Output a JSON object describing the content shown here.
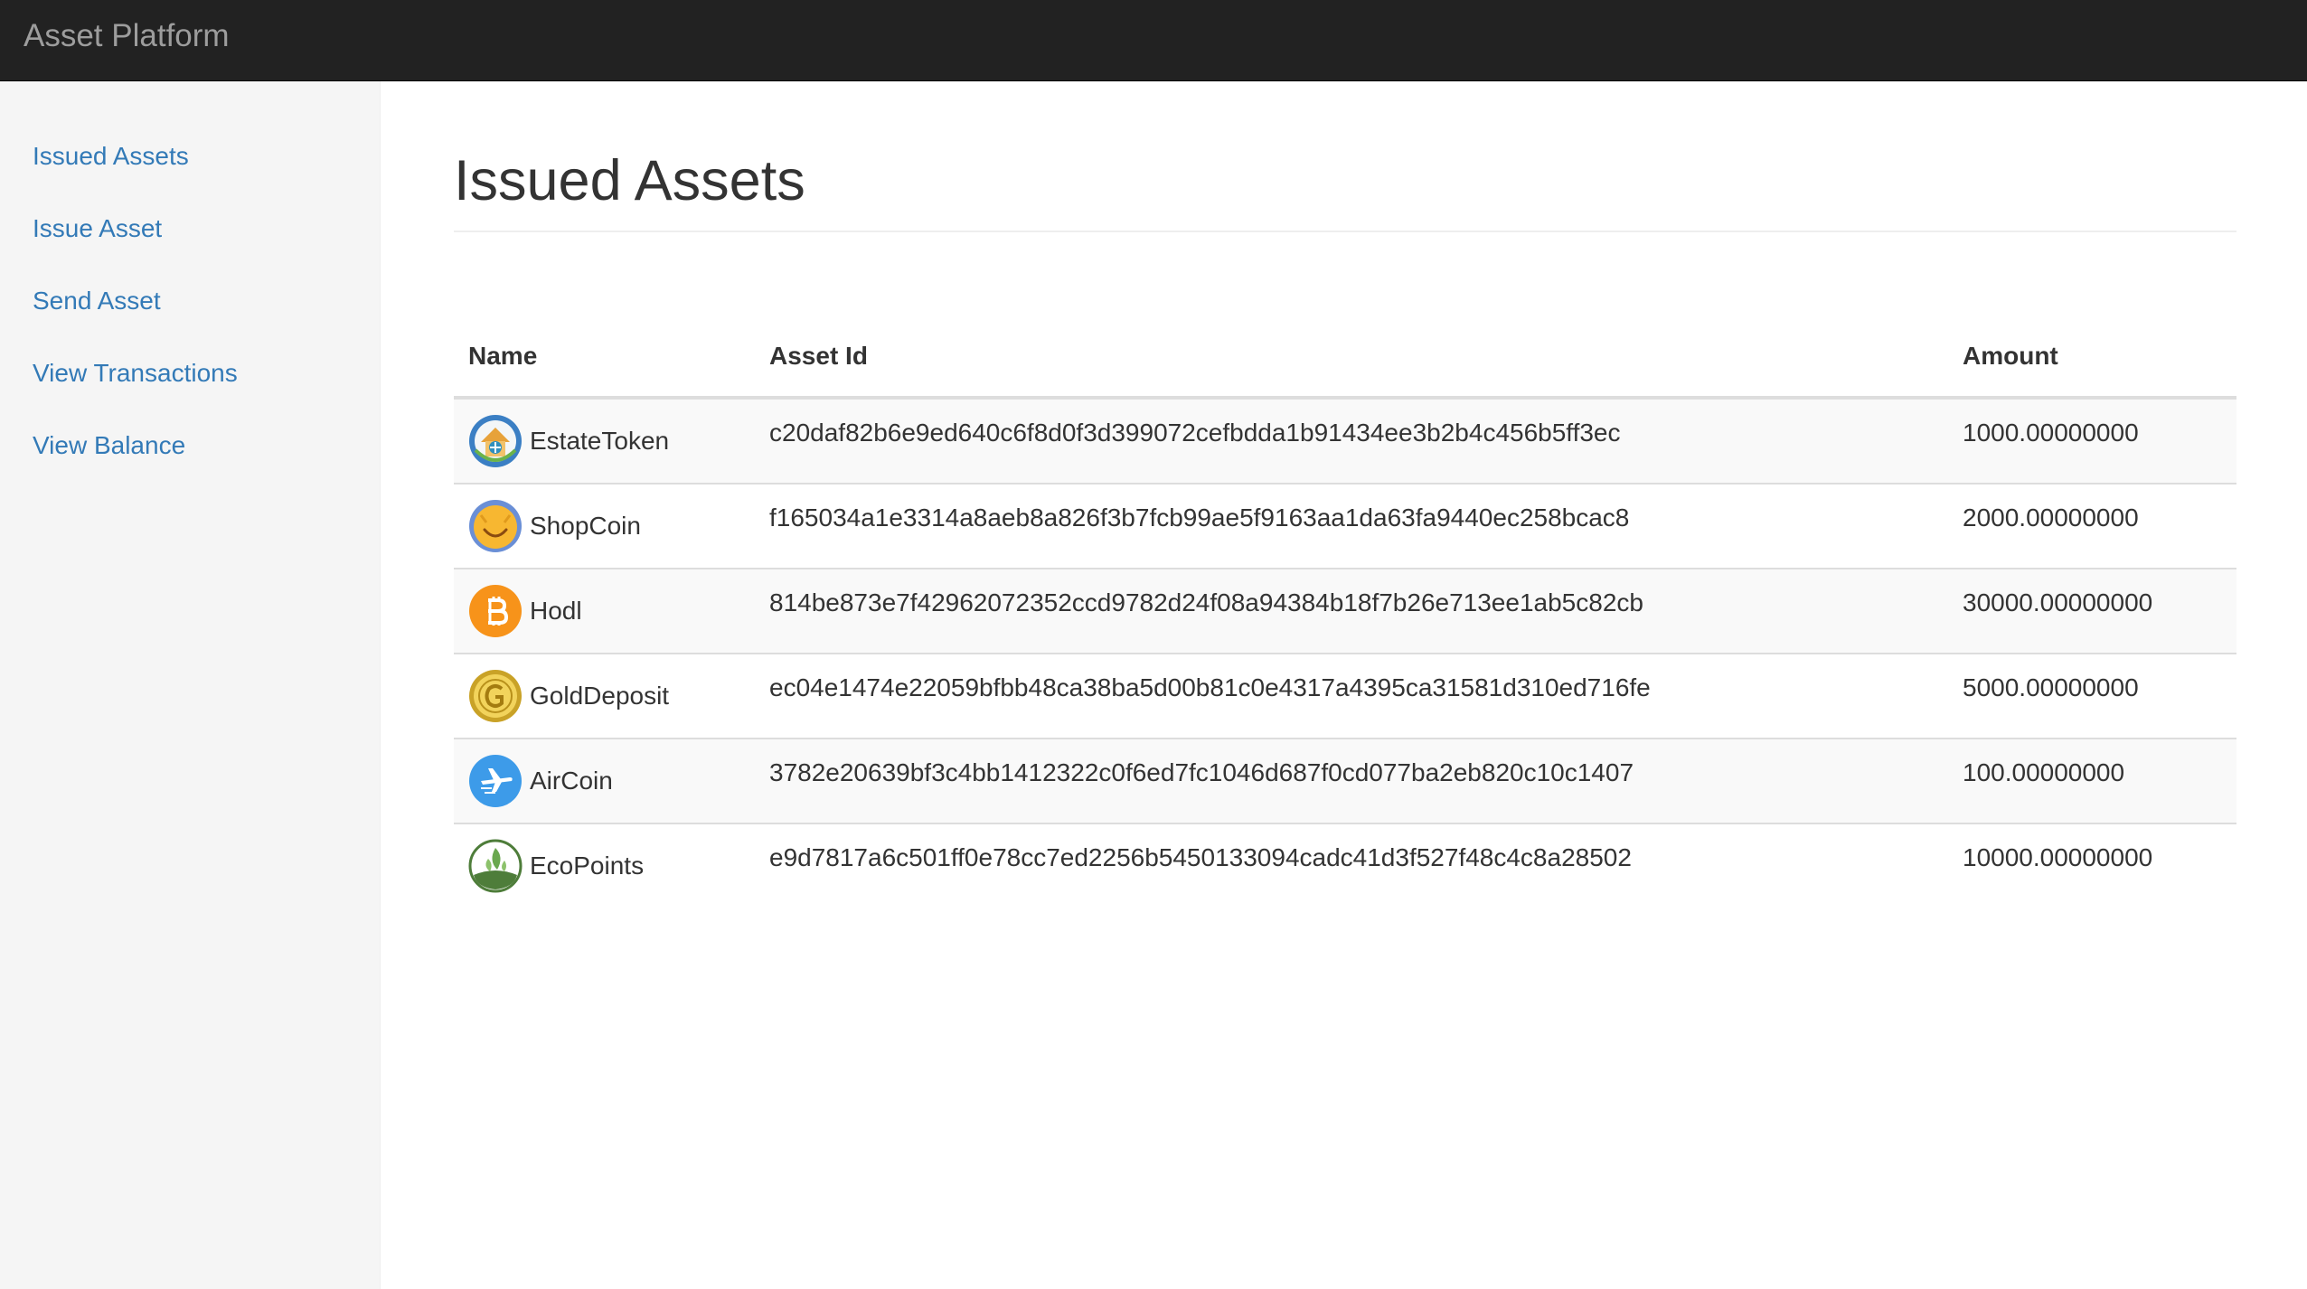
{
  "navbar": {
    "brand": "Asset Platform"
  },
  "sidebar": {
    "items": [
      {
        "label": "Issued Assets"
      },
      {
        "label": "Issue Asset"
      },
      {
        "label": "Send Asset"
      },
      {
        "label": "View Transactions"
      },
      {
        "label": "View Balance"
      }
    ]
  },
  "main": {
    "title": "Issued Assets",
    "table": {
      "headers": {
        "name": "Name",
        "asset_id": "Asset Id",
        "amount": "Amount"
      },
      "rows": [
        {
          "icon": "house-coin-icon",
          "name": "EstateToken",
          "asset_id": "c20daf82b6e9ed640c6f8d0f3d399072cefbdda1b91434ee3b2b4c456b5ff3ec",
          "amount": "1000.00000000"
        },
        {
          "icon": "smiley-coin-icon",
          "name": "ShopCoin",
          "asset_id": "f165034a1e3314a8aeb8a826f3b7fcb99ae5f9163aa1da63fa9440ec258bcac8",
          "amount": "2000.00000000"
        },
        {
          "icon": "bitcoin-icon",
          "name": "Hodl",
          "asset_id": "814be873e7f42962072352ccd9782d24f08a94384b18f7b26e713ee1ab5c82cb",
          "amount": "30000.00000000"
        },
        {
          "icon": "gold-coin-icon",
          "name": "GoldDeposit",
          "asset_id": "ec04e1474e22059bfbb48ca38ba5d00b81c0e4317a4395ca31581d310ed716fe",
          "amount": "5000.00000000"
        },
        {
          "icon": "airplane-coin-icon",
          "name": "AirCoin",
          "asset_id": "3782e20639bf3c4bb1412322c0f6ed7fc1046d687f0cd077ba2eb820c10c1407",
          "amount": "100.00000000"
        },
        {
          "icon": "leaf-coin-icon",
          "name": "EcoPoints",
          "asset_id": "e9d7817a6c501ff0e78cc7ed2256b5450133094cadc41d3f527f48c4c8a28502",
          "amount": "10000.00000000"
        }
      ]
    }
  },
  "colors": {
    "navbar_bg": "#222222",
    "brand_text": "#9d9d9d",
    "link": "#337ab7",
    "sidebar_bg": "#f5f5f5",
    "stripe": "#f9f9f9",
    "border": "#dddddd"
  }
}
